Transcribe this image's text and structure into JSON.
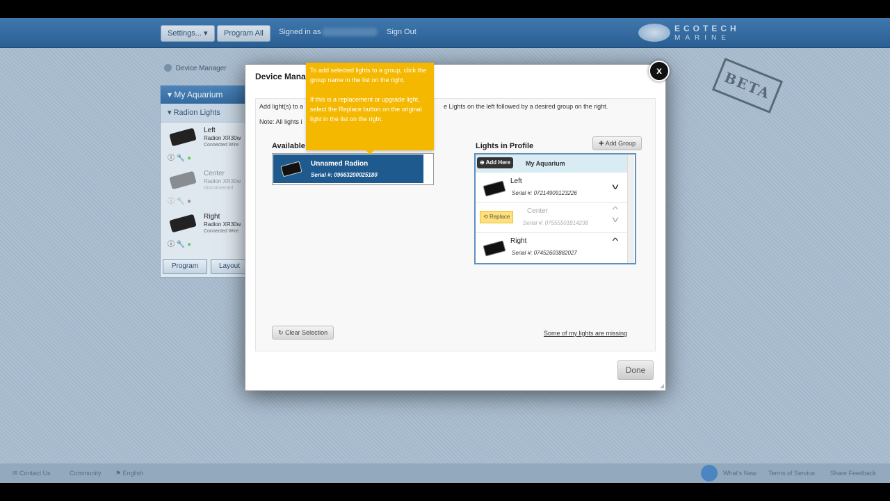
{
  "topbar": {
    "settings_label": "Settings...",
    "settings_chevron": "▾",
    "program_all_label": "Program All",
    "signed_in_label": "Signed in as",
    "sign_out_label": "Sign Out",
    "logo_line1": "ECOTECH",
    "logo_line2": "MARINE"
  },
  "beta_stamp": "BETA",
  "breadcrumb": "Device Manager",
  "sidebar": {
    "aquarium_label": "My Aquarium",
    "group_label": "Radion Lights",
    "items": [
      {
        "name": "Left",
        "model": "Radion XR30w",
        "status": "Connected Wire"
      },
      {
        "name": "Center",
        "model": "Radion XR30w",
        "status": "Disconnected"
      },
      {
        "name": "Right",
        "model": "Radion XR30w",
        "status": "Connected Wire"
      }
    ],
    "program_label": "Program",
    "layout_label": "Layout"
  },
  "modal": {
    "title": "Device Manager",
    "close_glyph": "x",
    "intro_left": "Add light(s) to a",
    "intro_right": "e Lights on the left followed by a desired group on the right.",
    "note": "Note: All lights i",
    "available_header": "Available",
    "available_lights": [
      {
        "name": "Unnamed Radion",
        "serial": "Serial #: 09663200025180"
      }
    ],
    "tooltip_p1": "To add selected lights to a group, click the group name in the list on the right.",
    "tooltip_p2": "If this is a replacement or upgrade light, select the Replace button on the original light in the list on the right.",
    "profile_header": "Lights in Profile",
    "add_group_label": "Add Group",
    "add_here_label": "Add Here",
    "group_name": "My Aquarium",
    "profile_lights": [
      {
        "name": "Left",
        "serial": "Serial #: 07214909123226"
      },
      {
        "name": "Center",
        "serial": "Serial #: 07555501814238",
        "replace_label": "Replace"
      },
      {
        "name": "Right",
        "serial": "Serial #: 07452603882027"
      }
    ],
    "clear_selection_label": "Clear Selection",
    "missing_link": "Some of my lights are missing",
    "done_label": "Done"
  },
  "footer": {
    "contact": "Contact Us",
    "community": "Community",
    "language": "English",
    "whats_new": "What's New",
    "terms": "Terms of Service",
    "share": "Share Feedback"
  }
}
